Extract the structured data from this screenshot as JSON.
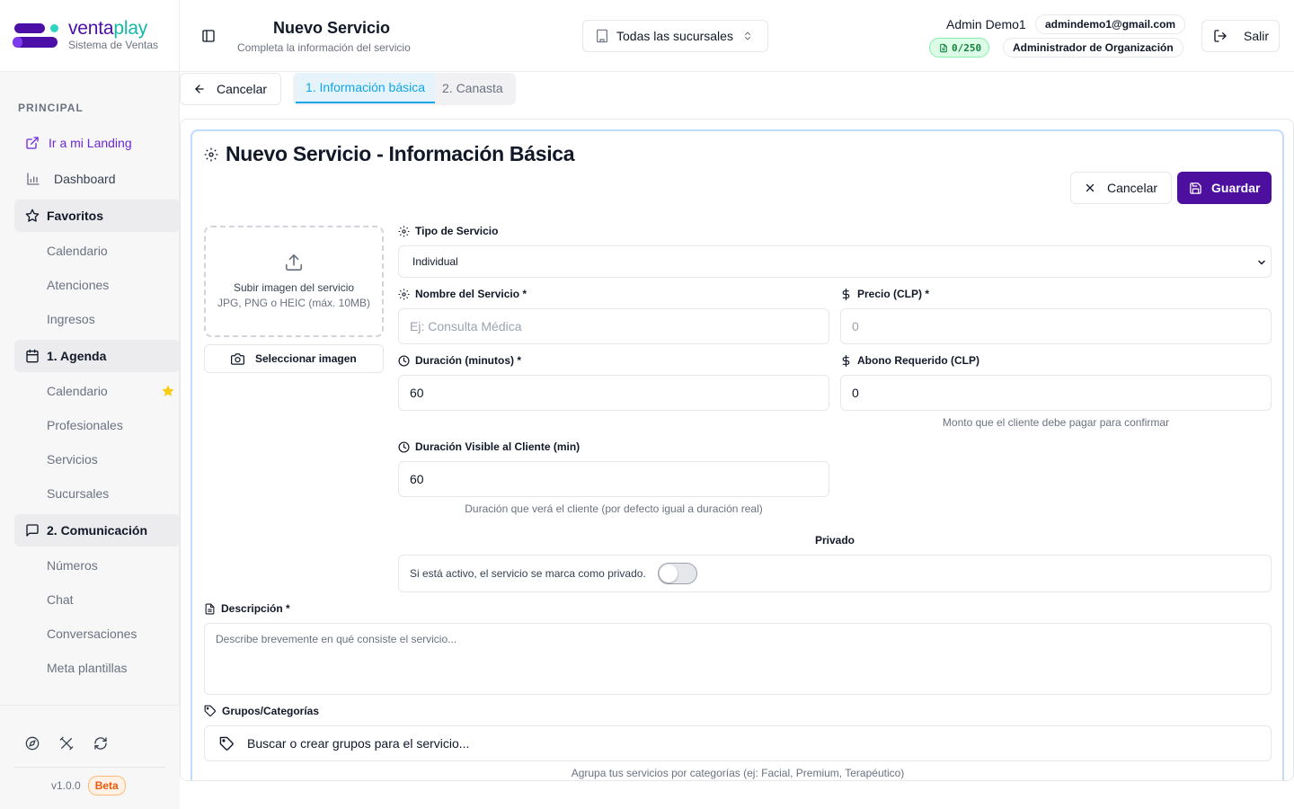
{
  "brand": {
    "name_part1": "venta",
    "name_part2": "play",
    "subtitle": "Sistema de Ventas"
  },
  "sidebar": {
    "section_principal": "PRINCIPAL",
    "landing_link": "Ir a mi Landing",
    "dashboard": "Dashboard",
    "favoritos": {
      "label": "Favoritos",
      "items": [
        "Calendario",
        "Atenciones",
        "Ingresos"
      ]
    },
    "agenda": {
      "label": "1. Agenda",
      "items": [
        "Calendario",
        "Profesionales",
        "Servicios",
        "Sucursales"
      ]
    },
    "comunicacion": {
      "label": "2. Comunicación",
      "items": [
        "Números",
        "Chat",
        "Conversaciones",
        "Meta plantillas"
      ]
    },
    "version": "v1.0.0",
    "beta": "Beta"
  },
  "header": {
    "title": "Nuevo Servicio",
    "subtitle": "Completa la información del servicio",
    "branch_selector": "Todas las sucursales",
    "user_name": "Admin Demo1",
    "email": "admindemo1@gmail.com",
    "quota": "0/250",
    "role": "Administrador de Organización",
    "logout": "Salir"
  },
  "steps": {
    "back": "Cancelar",
    "tab1": "1. Información básica",
    "tab2": "2. Canasta"
  },
  "form": {
    "title": "Nuevo Servicio - Información Básica",
    "cancel": "Cancelar",
    "save": "Guardar",
    "upload_title": "Subir imagen del servicio",
    "upload_hint": "JPG, PNG o HEIC (máx. 10MB)",
    "select_image": "Seleccionar imagen",
    "tipo_label": "Tipo de Servicio",
    "tipo_value": "Individual",
    "nombre_label": "Nombre del Servicio *",
    "nombre_placeholder": "Ej: Consulta Médica",
    "precio_label": "Precio (CLP) *",
    "precio_placeholder": "0",
    "duracion_label": "Duración (minutos) *",
    "duracion_value": "60",
    "abono_label": "Abono Requerido (CLP)",
    "abono_value": "0",
    "abono_help": "Monto que el cliente debe pagar para confirmar",
    "duracion_visible_label": "Duración Visible al Cliente (min)",
    "duracion_visible_value": "60",
    "duracion_visible_help": "Duración que verá el cliente (por defecto igual a duración real)",
    "privado_title": "Privado",
    "privado_text": "Si está activo, el servicio se marca como privado.",
    "descripcion_label": "Descripción *",
    "descripcion_placeholder": "Describe brevemente en qué consiste el servicio...",
    "grupos_label": "Grupos/Categorías",
    "grupos_placeholder": "Buscar o crear grupos para el servicio...",
    "grupos_help": "Agrupa tus servicios por categorías (ej: Facial, Premium, Terapéutico)"
  },
  "colors": {
    "primary": "#4c0f9e",
    "accent": "#14b8a6",
    "tab_active": "#0ea5e9"
  }
}
